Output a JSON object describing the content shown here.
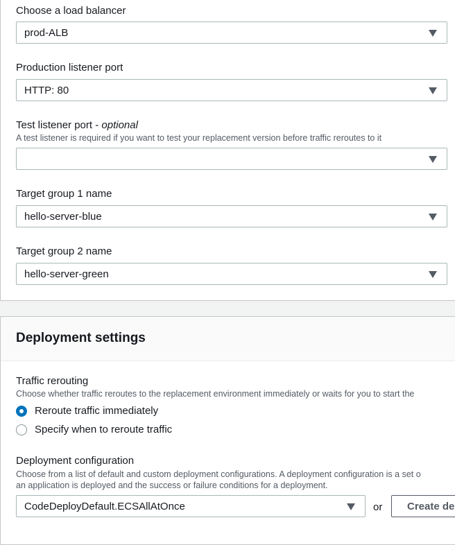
{
  "load_balancer": {
    "label": "Choose a load balancer",
    "value": "prod-ALB"
  },
  "production_listener_port": {
    "label": "Production listener port",
    "value": "HTTP: 80"
  },
  "test_listener_port": {
    "label": "Test listener port - ",
    "label_optional": "optional",
    "description": "A test listener is required if you want to test your replacement version before traffic reroutes to it",
    "value": ""
  },
  "target_group_1": {
    "label": "Target group 1 name",
    "value": "hello-server-blue"
  },
  "target_group_2": {
    "label": "Target group 2 name",
    "value": "hello-server-green"
  },
  "deployment_settings": {
    "title": "Deployment settings",
    "traffic_rerouting": {
      "label": "Traffic rerouting",
      "description": "Choose whether traffic reroutes to the replacement environment immediately or waits for you to start the",
      "options": [
        {
          "label": "Reroute traffic immediately",
          "selected": true
        },
        {
          "label": "Specify when to reroute traffic",
          "selected": false
        }
      ]
    },
    "deployment_configuration": {
      "label": "Deployment configuration",
      "description_line1": "Choose from a list of default and custom deployment configurations. A deployment configuration is a set o",
      "description_line2": "an application is deployed and the success or failure conditions for a deployment.",
      "value": "CodeDeployDefault.ECSAllAtOnce",
      "or_text": "or",
      "create_button_label": "Create de"
    }
  },
  "colors": {
    "accent": "#0073bb",
    "text": "#16191f",
    "secondary_text": "#545b64",
    "border": "#aab7b8"
  }
}
